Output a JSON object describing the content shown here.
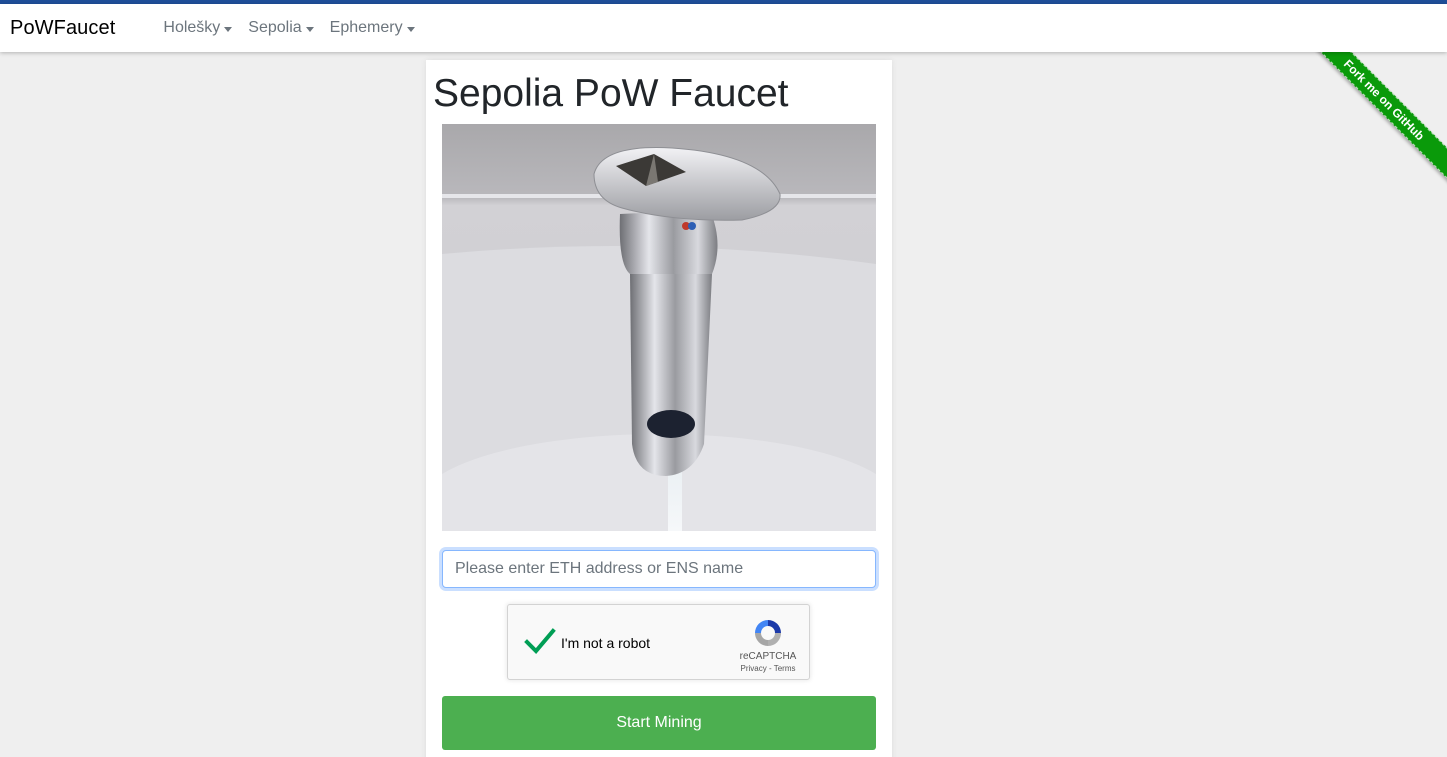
{
  "colors": {
    "top_border": "#1f4e99",
    "ribbon": "#0a9a0a",
    "start_button": "#4caf50",
    "checkmark": "#009e55"
  },
  "navbar": {
    "brand": "PoWFaucet",
    "items": [
      {
        "label": "Holešky"
      },
      {
        "label": "Sepolia"
      },
      {
        "label": "Ephemery"
      }
    ]
  },
  "ribbon": {
    "text": "Fork me on GitHub"
  },
  "main": {
    "title": "Sepolia PoW Faucet",
    "image_icon": "ethereum-faucet-image",
    "address_input": {
      "value": "",
      "placeholder": "Please enter ETH address or ENS name"
    },
    "recaptcha": {
      "label": "I'm not a robot",
      "brand": "reCAPTCHA",
      "privacy": "Privacy",
      "separator": " - ",
      "terms": "Terms",
      "checked": true
    },
    "start_button": "Start Mining"
  }
}
